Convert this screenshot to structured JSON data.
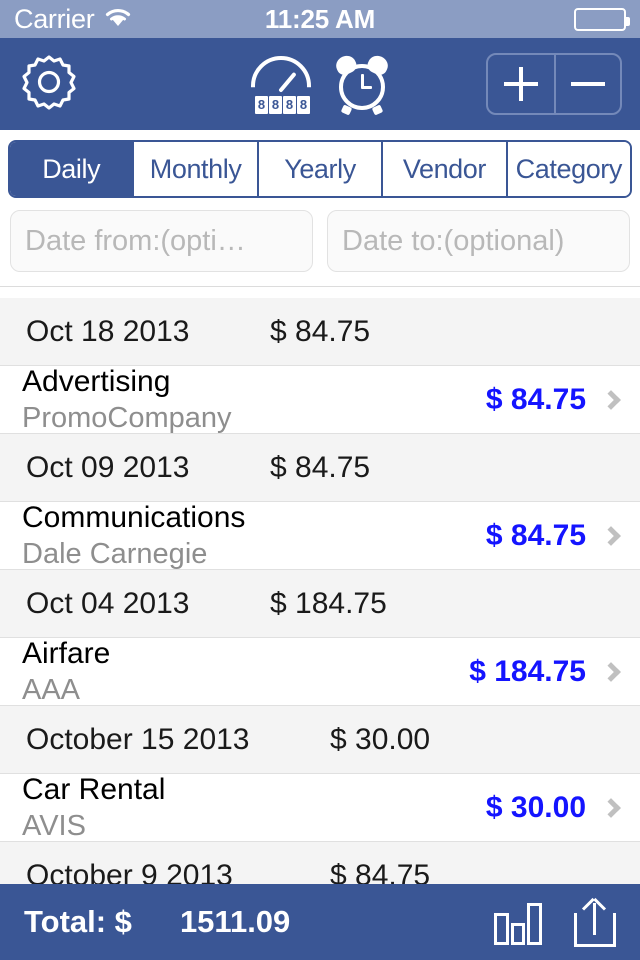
{
  "status_bar": {
    "carrier": "Carrier",
    "time": "11:25 AM",
    "wifi_icon": "wifi-icon",
    "battery_icon": "battery-icon"
  },
  "nav_bar": {
    "gear_icon": "gear-icon",
    "odometer_icon": "odometer-icon",
    "odometer_digits": "8888",
    "alarm_icon": "alarm-clock-icon",
    "add_label": "+",
    "remove_label": "−",
    "background_color": "#3a5695"
  },
  "tabs": [
    {
      "label": "Daily",
      "active": true
    },
    {
      "label": "Monthly",
      "active": false
    },
    {
      "label": "Yearly",
      "active": false
    },
    {
      "label": "Vendor",
      "active": false
    },
    {
      "label": "Category",
      "active": false
    }
  ],
  "filters": {
    "date_from_placeholder": "Date from:(opti…",
    "date_from_value": "",
    "date_to_placeholder": "Date to:(optional)",
    "date_to_value": ""
  },
  "list": [
    {
      "header_date": "Oct 18 2013",
      "header_amount": "$ 84.75",
      "category": "Advertising",
      "vendor": "PromoCompany",
      "amount": "$ 84.75"
    },
    {
      "header_date": "Oct 09 2013",
      "header_amount": "$ 84.75",
      "category": "Communications",
      "vendor": "Dale Carnegie",
      "amount": "$ 84.75"
    },
    {
      "header_date": "Oct 04 2013",
      "header_amount": "$ 184.75",
      "category": "Airfare",
      "vendor": "AAA",
      "amount": "$ 184.75"
    },
    {
      "header_date": "October 15 2013",
      "header_amount": "$ 30.00",
      "category": "Car Rental",
      "vendor": "AVIS",
      "amount": "$ 30.00"
    }
  ],
  "last_partial_header": {
    "header_date": "October 9 2013",
    "header_amount": "$ 84.75"
  },
  "bottom_bar": {
    "total_label": "Total: $",
    "total_value": "1511.09",
    "chart_icon": "bar-chart-icon",
    "share_icon": "share-icon"
  },
  "colors": {
    "navy": "#3a5695",
    "status_bar": "#8b9dc3",
    "amount_blue": "#1414ff",
    "header_row": "#f4f4f4"
  }
}
